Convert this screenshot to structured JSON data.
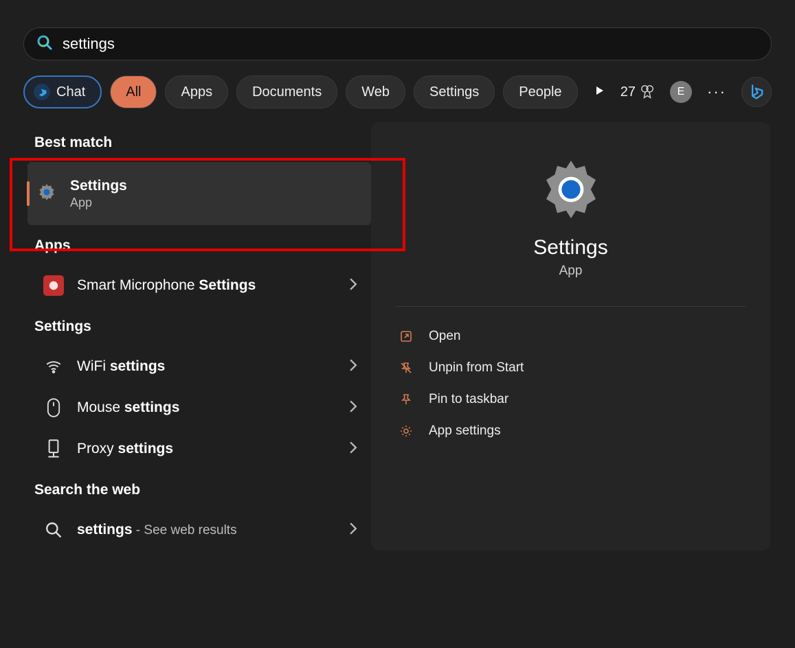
{
  "search": {
    "value": "settings"
  },
  "tabs": {
    "chat": "Chat",
    "all": "All",
    "apps": "Apps",
    "documents": "Documents",
    "web": "Web",
    "settings": "Settings",
    "people": "People"
  },
  "rewards": {
    "count": "27"
  },
  "avatar": {
    "letter": "E"
  },
  "sections": {
    "best_match": "Best match",
    "apps": "Apps",
    "settings": "Settings",
    "web": "Search the web"
  },
  "results": {
    "best": {
      "title": "Settings",
      "sub": "App"
    },
    "app1_pre": "Smart Microphone ",
    "app1_bold": "Settings",
    "wifi_pre": "WiFi ",
    "wifi_bold": "settings",
    "mouse_pre": "Mouse ",
    "mouse_bold": "settings",
    "proxy_pre": "Proxy ",
    "proxy_bold": "settings",
    "web_bold": "settings",
    "web_suffix": " - See web results"
  },
  "preview": {
    "title": "Settings",
    "sub": "App",
    "actions": {
      "open": "Open",
      "unpin": "Unpin from Start",
      "pin_taskbar": "Pin to taskbar",
      "app_settings": "App settings"
    }
  }
}
